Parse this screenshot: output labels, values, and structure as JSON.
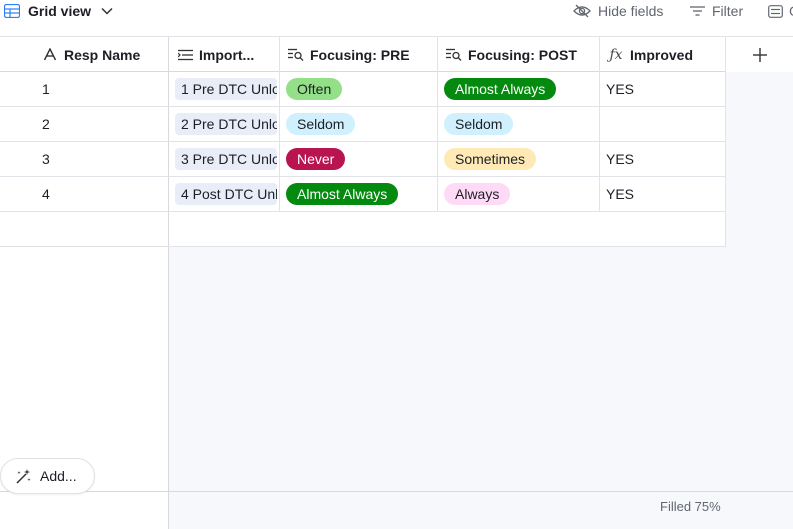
{
  "toolbar": {
    "view_name": "Grid view",
    "hide_fields": "Hide fields",
    "filter": "Filter",
    "group_partial": "G"
  },
  "columns": [
    {
      "label": "Resp Name",
      "icon": "text-type-icon"
    },
    {
      "label": "Import...",
      "icon": "lookup-icon"
    },
    {
      "label": "Focusing: PRE",
      "icon": "single-select-lookup-icon"
    },
    {
      "label": "Focusing: POST",
      "icon": "single-select-lookup-icon"
    },
    {
      "label": "Improved",
      "icon": "formula-icon"
    }
  ],
  "rows": [
    {
      "num": "1",
      "linked": "1 Pre DTC Unlo",
      "pre": "Often",
      "post": "Almost Always",
      "improved": "YES"
    },
    {
      "num": "2",
      "linked": "2 Pre DTC Unlo",
      "pre": "Seldom",
      "post": "Seldom",
      "improved": ""
    },
    {
      "num": "3",
      "linked": "3 Pre DTC Unlo",
      "pre": "Never",
      "post": "Sometimes",
      "improved": "YES"
    },
    {
      "num": "4",
      "linked": "4 Post DTC Unl",
      "pre": "Almost Always",
      "post": "Always",
      "improved": "YES"
    }
  ],
  "pill_colors": {
    "Often": {
      "bg": "#93e088",
      "fg": "#1d1f25"
    },
    "Almost Always": {
      "bg": "#048a0e",
      "fg": "#ffffff"
    },
    "Seldom": {
      "bg": "#d0f0fd",
      "fg": "#1d1f25"
    },
    "Never": {
      "bg": "#b8144f",
      "fg": "#ffffff"
    },
    "Sometimes": {
      "bg": "#ffeab6",
      "fg": "#1d1f25"
    },
    "Always": {
      "bg": "#ffdaf6",
      "fg": "#1d1f25"
    }
  },
  "add_button": "Add...",
  "summary": "Filled 75%"
}
